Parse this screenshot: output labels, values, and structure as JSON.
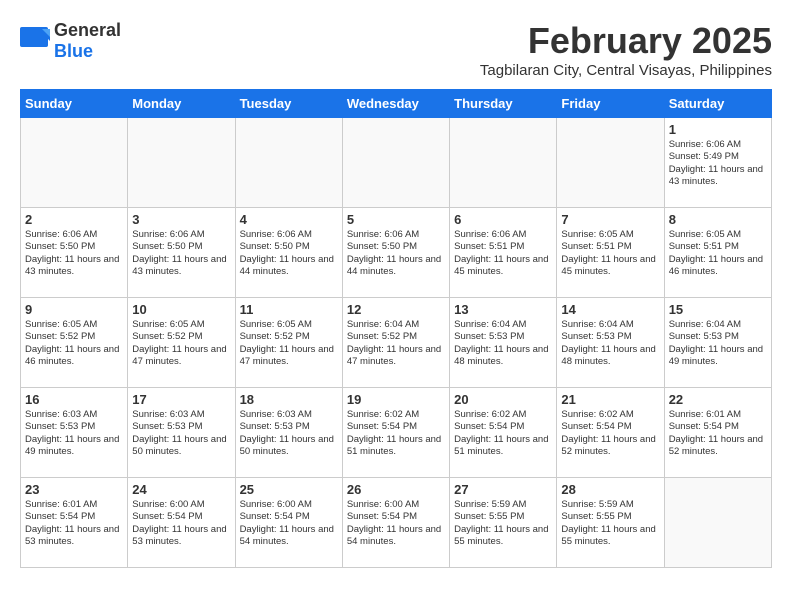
{
  "logo": {
    "general": "General",
    "blue": "Blue"
  },
  "title": "February 2025",
  "subtitle": "Tagbilaran City, Central Visayas, Philippines",
  "weekdays": [
    "Sunday",
    "Monday",
    "Tuesday",
    "Wednesday",
    "Thursday",
    "Friday",
    "Saturday"
  ],
  "weeks": [
    [
      null,
      null,
      null,
      null,
      null,
      null,
      {
        "day": 1,
        "sunrise": "Sunrise: 6:06 AM",
        "sunset": "Sunset: 5:49 PM",
        "daylight": "Daylight: 11 hours and 43 minutes."
      }
    ],
    [
      {
        "day": 2,
        "sunrise": "Sunrise: 6:06 AM",
        "sunset": "Sunset: 5:50 PM",
        "daylight": "Daylight: 11 hours and 43 minutes."
      },
      {
        "day": 3,
        "sunrise": "Sunrise: 6:06 AM",
        "sunset": "Sunset: 5:50 PM",
        "daylight": "Daylight: 11 hours and 43 minutes."
      },
      {
        "day": 4,
        "sunrise": "Sunrise: 6:06 AM",
        "sunset": "Sunset: 5:50 PM",
        "daylight": "Daylight: 11 hours and 44 minutes."
      },
      {
        "day": 5,
        "sunrise": "Sunrise: 6:06 AM",
        "sunset": "Sunset: 5:50 PM",
        "daylight": "Daylight: 11 hours and 44 minutes."
      },
      {
        "day": 6,
        "sunrise": "Sunrise: 6:06 AM",
        "sunset": "Sunset: 5:51 PM",
        "daylight": "Daylight: 11 hours and 45 minutes."
      },
      {
        "day": 7,
        "sunrise": "Sunrise: 6:05 AM",
        "sunset": "Sunset: 5:51 PM",
        "daylight": "Daylight: 11 hours and 45 minutes."
      },
      {
        "day": 8,
        "sunrise": "Sunrise: 6:05 AM",
        "sunset": "Sunset: 5:51 PM",
        "daylight": "Daylight: 11 hours and 46 minutes."
      }
    ],
    [
      {
        "day": 9,
        "sunrise": "Sunrise: 6:05 AM",
        "sunset": "Sunset: 5:52 PM",
        "daylight": "Daylight: 11 hours and 46 minutes."
      },
      {
        "day": 10,
        "sunrise": "Sunrise: 6:05 AM",
        "sunset": "Sunset: 5:52 PM",
        "daylight": "Daylight: 11 hours and 47 minutes."
      },
      {
        "day": 11,
        "sunrise": "Sunrise: 6:05 AM",
        "sunset": "Sunset: 5:52 PM",
        "daylight": "Daylight: 11 hours and 47 minutes."
      },
      {
        "day": 12,
        "sunrise": "Sunrise: 6:04 AM",
        "sunset": "Sunset: 5:52 PM",
        "daylight": "Daylight: 11 hours and 47 minutes."
      },
      {
        "day": 13,
        "sunrise": "Sunrise: 6:04 AM",
        "sunset": "Sunset: 5:53 PM",
        "daylight": "Daylight: 11 hours and 48 minutes."
      },
      {
        "day": 14,
        "sunrise": "Sunrise: 6:04 AM",
        "sunset": "Sunset: 5:53 PM",
        "daylight": "Daylight: 11 hours and 48 minutes."
      },
      {
        "day": 15,
        "sunrise": "Sunrise: 6:04 AM",
        "sunset": "Sunset: 5:53 PM",
        "daylight": "Daylight: 11 hours and 49 minutes."
      }
    ],
    [
      {
        "day": 16,
        "sunrise": "Sunrise: 6:03 AM",
        "sunset": "Sunset: 5:53 PM",
        "daylight": "Daylight: 11 hours and 49 minutes."
      },
      {
        "day": 17,
        "sunrise": "Sunrise: 6:03 AM",
        "sunset": "Sunset: 5:53 PM",
        "daylight": "Daylight: 11 hours and 50 minutes."
      },
      {
        "day": 18,
        "sunrise": "Sunrise: 6:03 AM",
        "sunset": "Sunset: 5:53 PM",
        "daylight": "Daylight: 11 hours and 50 minutes."
      },
      {
        "day": 19,
        "sunrise": "Sunrise: 6:02 AM",
        "sunset": "Sunset: 5:54 PM",
        "daylight": "Daylight: 11 hours and 51 minutes."
      },
      {
        "day": 20,
        "sunrise": "Sunrise: 6:02 AM",
        "sunset": "Sunset: 5:54 PM",
        "daylight": "Daylight: 11 hours and 51 minutes."
      },
      {
        "day": 21,
        "sunrise": "Sunrise: 6:02 AM",
        "sunset": "Sunset: 5:54 PM",
        "daylight": "Daylight: 11 hours and 52 minutes."
      },
      {
        "day": 22,
        "sunrise": "Sunrise: 6:01 AM",
        "sunset": "Sunset: 5:54 PM",
        "daylight": "Daylight: 11 hours and 52 minutes."
      }
    ],
    [
      {
        "day": 23,
        "sunrise": "Sunrise: 6:01 AM",
        "sunset": "Sunset: 5:54 PM",
        "daylight": "Daylight: 11 hours and 53 minutes."
      },
      {
        "day": 24,
        "sunrise": "Sunrise: 6:00 AM",
        "sunset": "Sunset: 5:54 PM",
        "daylight": "Daylight: 11 hours and 53 minutes."
      },
      {
        "day": 25,
        "sunrise": "Sunrise: 6:00 AM",
        "sunset": "Sunset: 5:54 PM",
        "daylight": "Daylight: 11 hours and 54 minutes."
      },
      {
        "day": 26,
        "sunrise": "Sunrise: 6:00 AM",
        "sunset": "Sunset: 5:54 PM",
        "daylight": "Daylight: 11 hours and 54 minutes."
      },
      {
        "day": 27,
        "sunrise": "Sunrise: 5:59 AM",
        "sunset": "Sunset: 5:55 PM",
        "daylight": "Daylight: 11 hours and 55 minutes."
      },
      {
        "day": 28,
        "sunrise": "Sunrise: 5:59 AM",
        "sunset": "Sunset: 5:55 PM",
        "daylight": "Daylight: 11 hours and 55 minutes."
      },
      null
    ]
  ]
}
